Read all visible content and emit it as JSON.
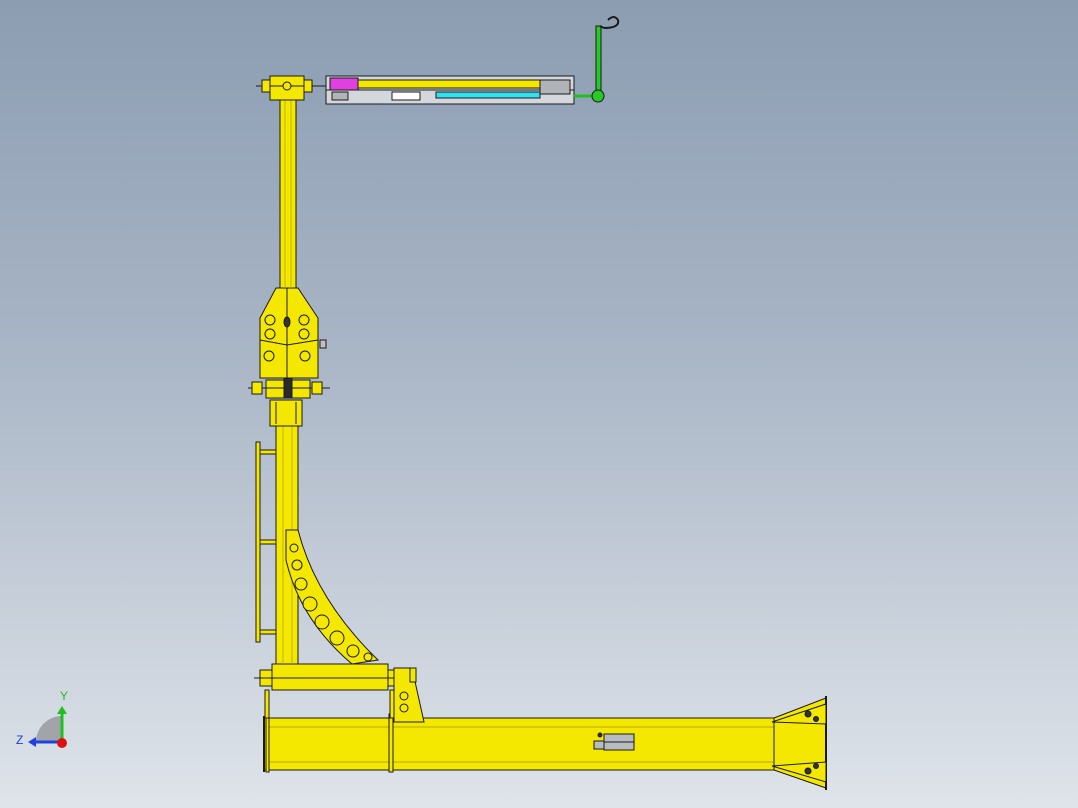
{
  "viewport": {
    "background_top": "#8c9db2",
    "background_bottom": "#dfe4ea"
  },
  "model": {
    "part_color": "#f5e800",
    "edge_color": "#1a1a1a",
    "hoist_color": "#d4d8dc",
    "magenta_part": "#e040e0",
    "cyan_part": "#30e0f0",
    "green_part": "#22cc22"
  },
  "triad": {
    "y_label": "Y",
    "z_label": "Z",
    "y_color": "#1fbf1f",
    "z_color": "#2040e0",
    "x_color": "#e01010"
  }
}
